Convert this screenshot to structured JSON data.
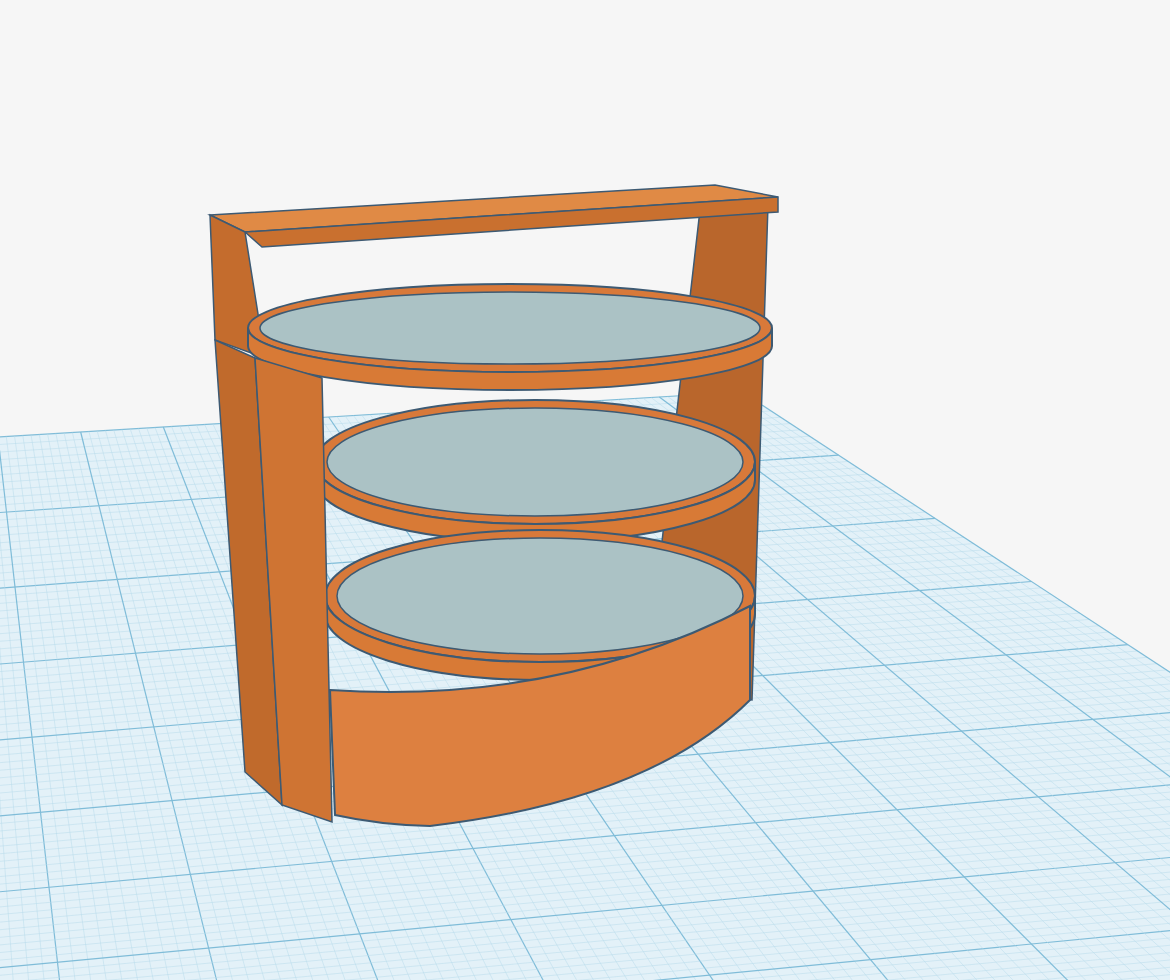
{
  "viewport": {
    "kind": "workplane",
    "model": {
      "kind": "shelf"
    }
  }
}
